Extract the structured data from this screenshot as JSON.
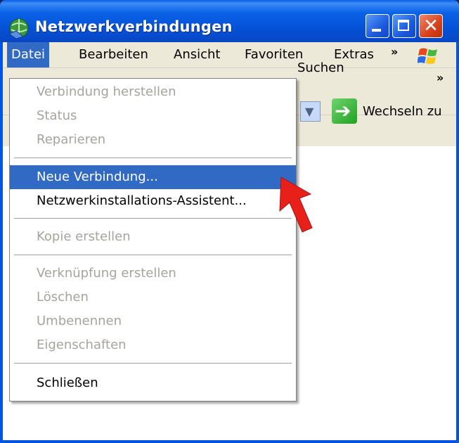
{
  "window": {
    "title": "Netzwerkverbindungen"
  },
  "menubar": {
    "items": [
      {
        "label": "Datei",
        "active": true
      },
      {
        "label": "Bearbeiten"
      },
      {
        "label": "Ansicht"
      },
      {
        "label": "Favoriten"
      },
      {
        "label": "Extras"
      }
    ],
    "overflow_glyph": "»"
  },
  "toolbar": {
    "search_label": "Suchen",
    "overflow_glyph": "»"
  },
  "addressbar": {
    "go_label": "Wechseln zu"
  },
  "file_menu": {
    "groups": [
      [
        {
          "label": "Verbindung herstellen",
          "enabled": false
        },
        {
          "label": "Status",
          "enabled": false
        },
        {
          "label": "Reparieren",
          "enabled": false
        }
      ],
      [
        {
          "label": "Neue Verbindung...",
          "enabled": true,
          "highlighted": true
        },
        {
          "label": "Netzwerkinstallations-Assistent...",
          "enabled": true
        }
      ],
      [
        {
          "label": "Kopie erstellen",
          "enabled": false
        }
      ],
      [
        {
          "label": "Verknüpfung erstellen",
          "enabled": false
        },
        {
          "label": "Löschen",
          "enabled": false
        },
        {
          "label": "Umbenennen",
          "enabled": false
        },
        {
          "label": "Eigenschaften",
          "enabled": false
        }
      ],
      [
        {
          "label": "Schließen",
          "enabled": true
        }
      ]
    ]
  },
  "colors": {
    "titlebar": "#0054e3",
    "menu_highlight": "#316ac5",
    "disabled_text": "#a6a49c",
    "annotation_arrow": "#e8201a"
  },
  "icons": {
    "app": "network-connections-icon",
    "go": "green-arrow-icon",
    "flag": "windows-logo-icon"
  }
}
